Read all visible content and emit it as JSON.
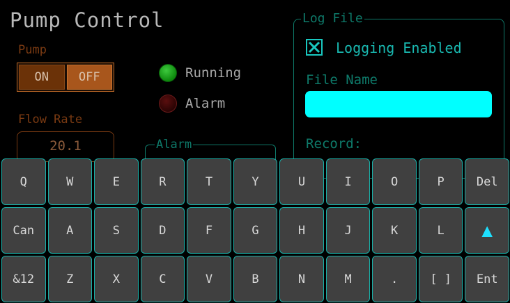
{
  "title": "Pump Control",
  "pump": {
    "label": "Pump",
    "on": "ON",
    "off": "OFF"
  },
  "indicators": {
    "running": "Running",
    "alarm": "Alarm"
  },
  "flow": {
    "label": "Flow Rate",
    "value": "20.1"
  },
  "alarm_group": {
    "legend": "Alarm"
  },
  "log": {
    "legend": "Log File",
    "logging_label": "Logging Enabled",
    "logging_checked": true,
    "file_name_label": "File Name",
    "file_name_value": "",
    "record_label": "Record:"
  },
  "keyboard": {
    "row1": [
      "Q",
      "W",
      "E",
      "R",
      "T",
      "Y",
      "U",
      "I",
      "O",
      "P",
      "Del"
    ],
    "row2": [
      "Can",
      "A",
      "S",
      "D",
      "F",
      "G",
      "H",
      "J",
      "K",
      "L",
      "▲"
    ],
    "row3": [
      "&12",
      "Z",
      "X",
      "C",
      "V",
      "B",
      "N",
      "M",
      ".",
      "[ ]",
      "Ent"
    ]
  },
  "colors": {
    "accent": "#19b0a8",
    "input": "#00ffff",
    "led_running": "#1faa1f",
    "led_alarm": "#3a0808",
    "orange": "#a8561c"
  }
}
